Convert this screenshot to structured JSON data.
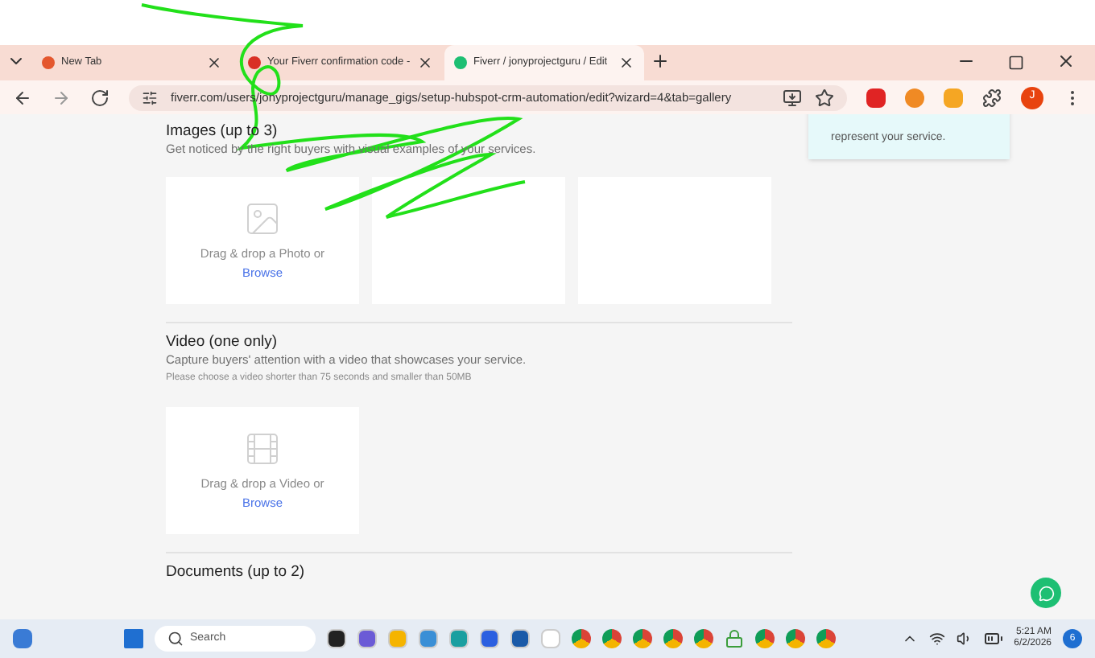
{
  "browser": {
    "tabs": [
      {
        "title": "New Tab",
        "selected": false
      },
      {
        "title": "Your Fiverr confirmation code -",
        "selected": false
      },
      {
        "title": "Fiverr / jonyprojectguru / Edit",
        "selected": true
      }
    ],
    "url": "fiverr.com/users/jonyprojectguru/manage_gigs/setup-hubspot-crm-automation/edit?wizard=4&tab=gallery",
    "profile_initial": "J"
  },
  "tooltip": {
    "text": "represent your service."
  },
  "sections": [
    {
      "title": "Images (up to 3)",
      "subtitle": "Get noticed by the right buyers with visual examples of your services.",
      "uploads": [
        {
          "kind": "photo",
          "prompt": "Drag & drop a Photo or",
          "link": "Browse"
        },
        {
          "kind": "empty"
        },
        {
          "kind": "empty"
        }
      ]
    },
    {
      "title": "Video (one only)",
      "subtitle": "Capture buyers' attention with a video that showcases your service.",
      "note": "Please choose a video shorter than 75 seconds and smaller than 50MB",
      "uploads": [
        {
          "kind": "video",
          "prompt": "Drag & drop a Video or",
          "link": "Browse"
        }
      ]
    },
    {
      "title": "Documents (up to 2)"
    }
  ],
  "taskbar": {
    "search_placeholder": "Search",
    "time": "5:21 AM",
    "date": "6/2/2026",
    "notifications": "6"
  }
}
